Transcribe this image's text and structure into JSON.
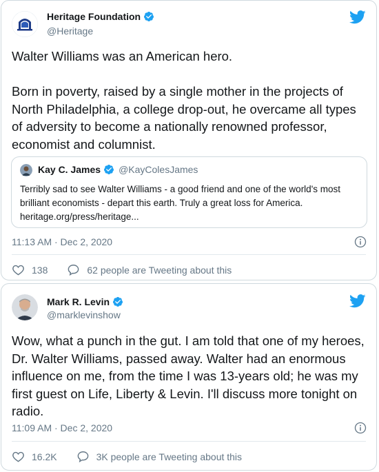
{
  "tweets": [
    {
      "author": "Heritage Foundation",
      "handle": "@Heritage",
      "text": "Walter Williams was an American hero.\n\nBorn in poverty, raised by a single mother in the projects of North Philadelphia, a college drop-out, he overcame all types of adversity to become a nationally renowned professor, economist and columnist.",
      "quote": {
        "author": "Kay C. James",
        "handle": "@KayColesJames",
        "text": "Terribly sad to see Walter Williams - a good friend and one of the world's most brilliant economists - depart this earth. Truly a great loss for America. heritage.org/press/heritage..."
      },
      "timestamp": "11:13 AM · Dec 2, 2020",
      "likes": "138",
      "conversation": "62 people are Tweeting about this"
    },
    {
      "author": "Mark R. Levin",
      "handle": "@marklevinshow",
      "text": "Wow, what a punch in the gut.  I am told that one of my heroes, Dr. Walter Williams, passed away. Walter had an enormous influence on me, from the time I was 13-years old; he was my first guest on Life, Liberty & Levin.  I'll discuss more tonight on radio.",
      "timestamp": "11:09 AM · Dec 2, 2020",
      "likes": "16.2K",
      "conversation": "3K people are Tweeting about this"
    }
  ],
  "colors": {
    "twitter_blue": "#1da1f2",
    "like_red": "#e0245e",
    "muted": "#657786",
    "border": "#cfd9de"
  }
}
